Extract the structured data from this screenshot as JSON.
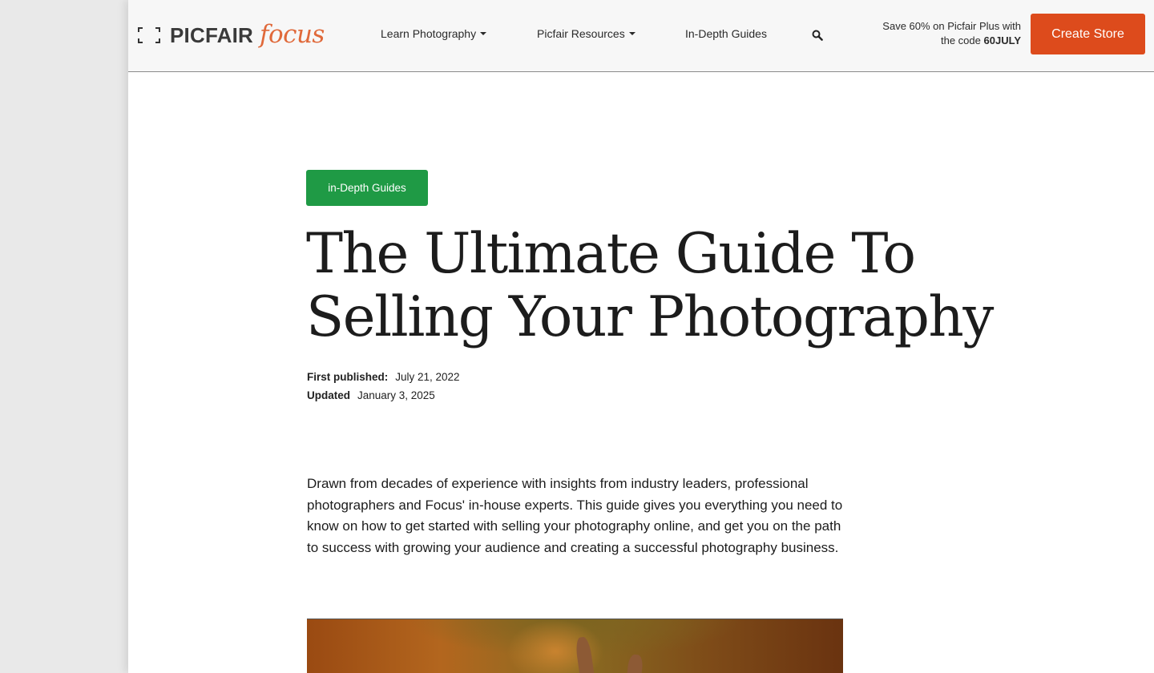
{
  "header": {
    "logo": {
      "brand": "PICFAIR",
      "sub": "focus"
    },
    "nav": [
      {
        "label": "Learn Photography",
        "has_dropdown": true
      },
      {
        "label": "Picfair Resources",
        "has_dropdown": true
      },
      {
        "label": "In-Depth Guides",
        "has_dropdown": false
      }
    ],
    "promo": {
      "text_line1": "Save 60% on Picfair Plus with",
      "text_prefix": "the code ",
      "code": "60JULY"
    },
    "cta_label": "Create Store"
  },
  "article": {
    "category": "in-Depth Guides",
    "title_line1": "The Ultimate Guide To",
    "title_line2": "Selling Your Photography",
    "meta": {
      "first_published_label": "First published:",
      "first_published": "July 21, 2022",
      "updated_label": "Updated",
      "updated": "January 3, 2025"
    },
    "lead": "Drawn from decades of experience with insights from industry leaders, professional photographers and Focus' in-house experts. This guide gives you everything you need to know on how to get started with selling your photography online, and get you on the path to success with growing your audience and creating a successful photography business."
  },
  "colors": {
    "accent": "#dd4b1c",
    "badge": "#1f9a45",
    "logo_sub": "#e0693a",
    "header_bg": "#f7f7f7"
  },
  "icons": {
    "search": "search-icon",
    "logo": "frame-icon",
    "dropdown": "caret-down-icon"
  }
}
